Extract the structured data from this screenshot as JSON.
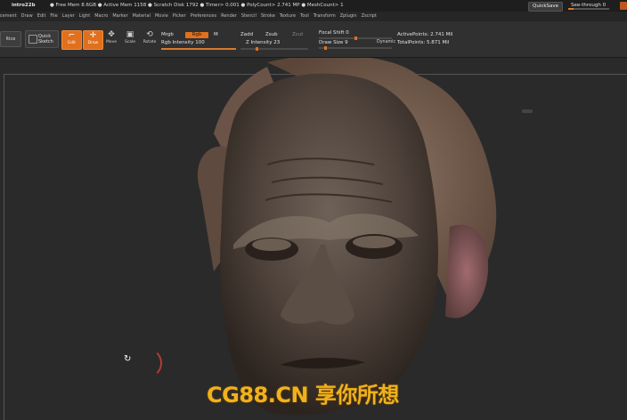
{
  "statusbar": {
    "title": "intro22b",
    "stats": "● Free Mem 8.6GB ● Active Mem 1158 ● Scratch Disk 1792 ● Timer> 0.001 ● PolyCount> 2.741 MP ● MeshCount> 1",
    "quicksave": "QuickSave",
    "see_through": "See-through 0",
    "see_through_value": 0
  },
  "menu": [
    "ccement",
    "Draw",
    "Edit",
    "File",
    "Layer",
    "Light",
    "Macro",
    "Marker",
    "Material",
    "Movie",
    "Picker",
    "Preferences",
    "Render",
    "Stencil",
    "Stroke",
    "Texture",
    "Tool",
    "Transform",
    "Zplugin",
    "Zscript"
  ],
  "toolbar": {
    "home_label": "ltice",
    "quick_sketch_label": "Quick Sketch",
    "edit_label": "Edit",
    "draw_label": "Draw",
    "move_label": "Move",
    "scale_label": "Scale",
    "rotate_label": "Rotate",
    "mrgb_label": "Mrgb",
    "rgb_label": "Rgb",
    "m_label": "M",
    "rgb_intensity_label": "Rgb Intensity 100",
    "zadd_label": "Zadd",
    "zsub_label": "Zsub",
    "zcut_label": "Zcut",
    "z_intensity_label": "Z Intensity 23",
    "focal_shift_label": "Focal Shift 0",
    "draw_size_label": "Draw Size 9",
    "dynamic_label": "Dynamic",
    "active_points_label": "ActivePoints: 2.741 Mil",
    "total_points_label": "TotalPoints: 5.871 Mil",
    "rgb_intensity_value": 100,
    "z_intensity_value": 23,
    "focal_shift_value": 0,
    "draw_size_value": 9
  },
  "watermark": "CG88.CN 享你所想",
  "colors": {
    "accent": "#e0701d",
    "background": "#2b2b2b",
    "watermark": "#f0b21c"
  }
}
